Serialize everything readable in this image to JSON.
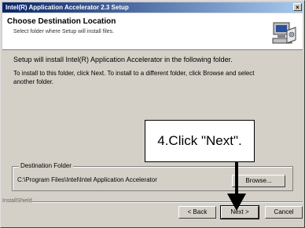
{
  "window": {
    "title": "Intel(R) Application Accelerator 2.3 Setup",
    "close_glyph": "×"
  },
  "header": {
    "title": "Choose Destination Location",
    "subtitle": "Select folder where Setup will install files."
  },
  "body": {
    "line1": "Setup will install Intel(R) Application Accelerator in the following folder.",
    "line2": "To install to this folder, click Next. To install to a different folder, click Browse and select",
    "line3": "another folder."
  },
  "destination": {
    "legend": "Destination Folder",
    "path": "C:\\Program Files\\Intel\\Intel Application Accelerator",
    "browse_label": "Browse..."
  },
  "footer": {
    "brand": "InstallShield",
    "back_label": "< Back",
    "next_label": "Next >",
    "cancel_label": "Cancel"
  },
  "annotation": {
    "text": "4.Click \"Next\"."
  }
}
